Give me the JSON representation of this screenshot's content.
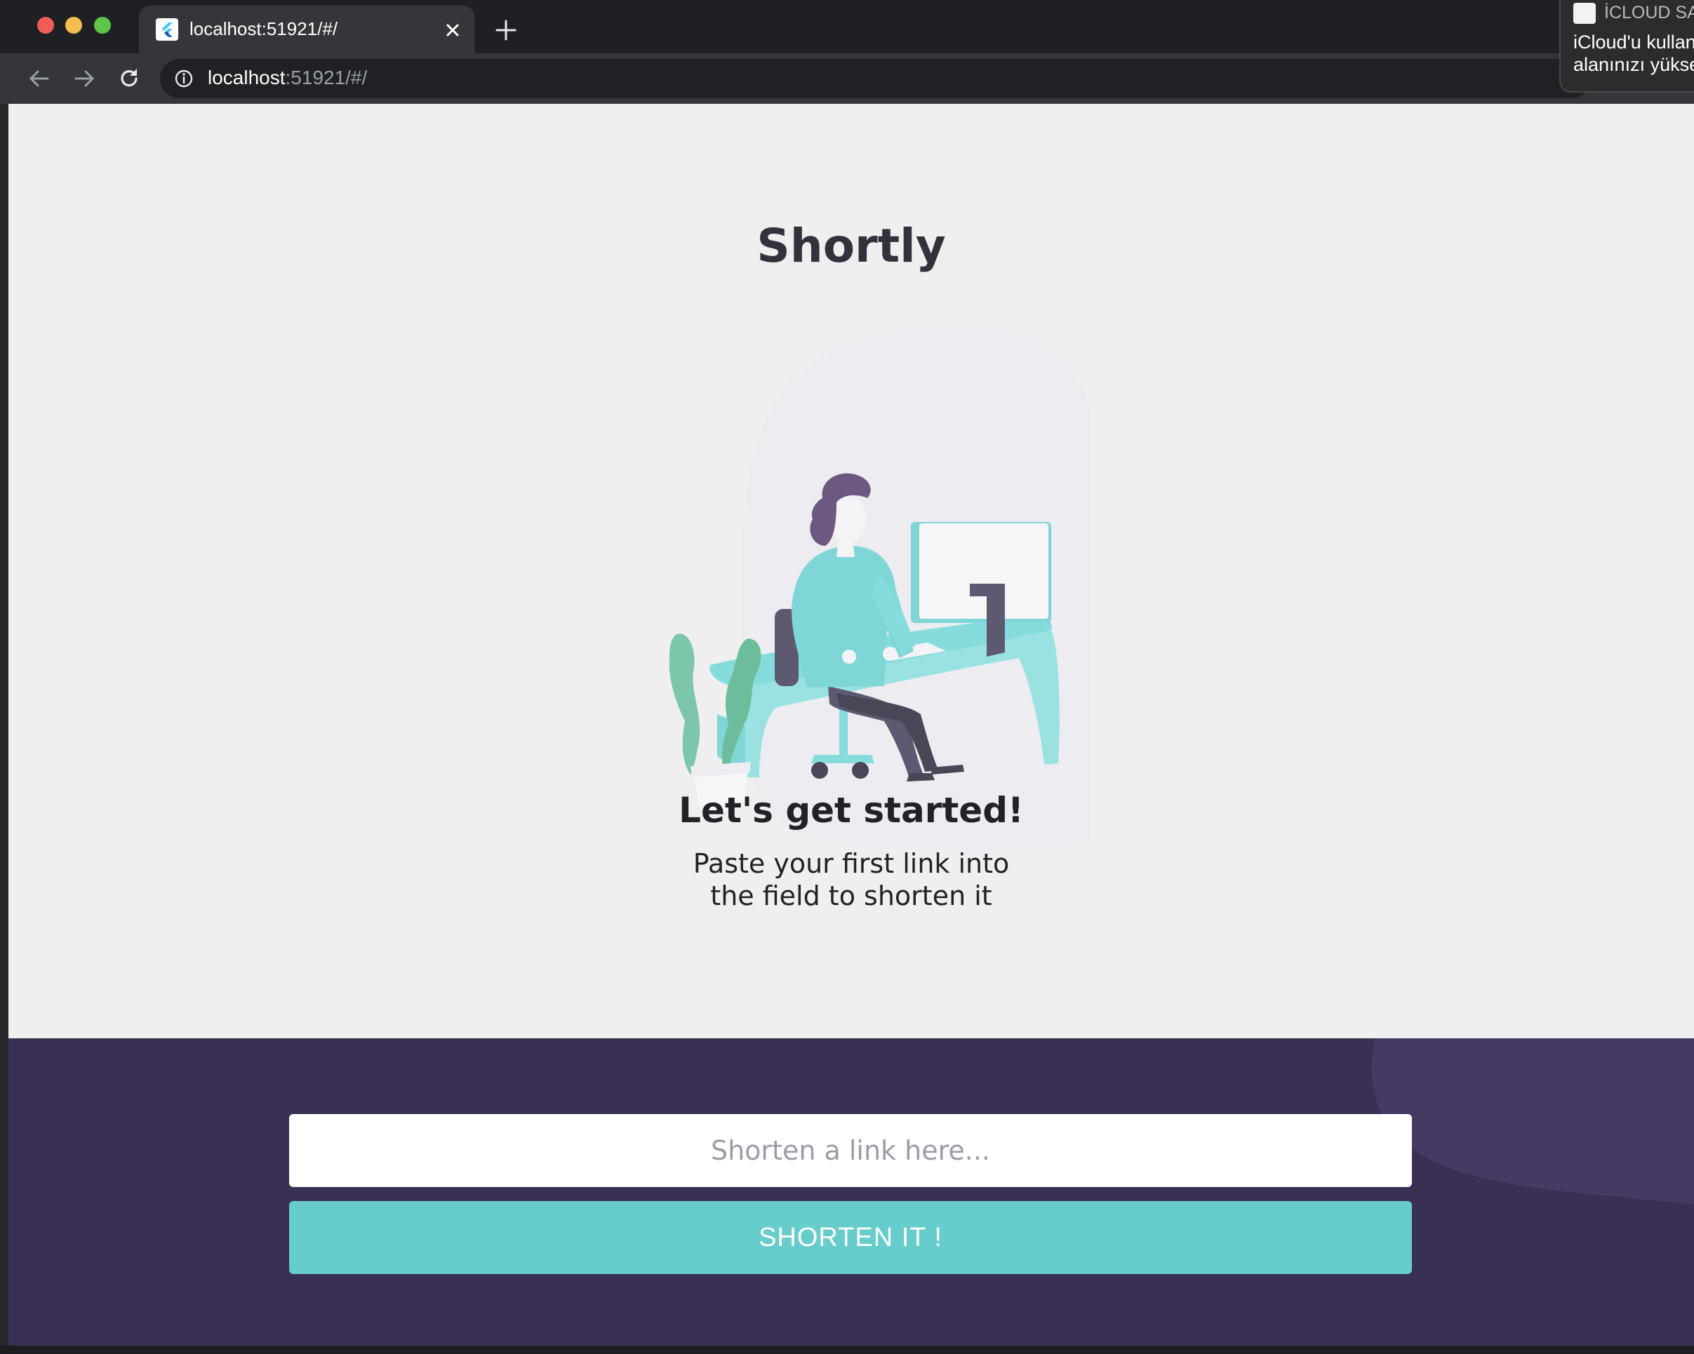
{
  "browser": {
    "tab_title": "localhost:51921/#/",
    "url_host": "localhost",
    "url_rest": ":51921/#/"
  },
  "notification": {
    "app": "İCLOUD SA",
    "line1": "iCloud'u kullan",
    "line2": "alanınızı yükse"
  },
  "page": {
    "title": "Shortly",
    "headline": "Let's get started!",
    "subtext_line1": "Paste your first link into",
    "subtext_line2": "the field to shorten it"
  },
  "form": {
    "placeholder": "Shorten a link here...",
    "button_label": "SHORTEN IT !"
  },
  "colors": {
    "background": "#efefef",
    "panel": "#3a3054",
    "accent": "#66cccc",
    "title": "#34313d"
  },
  "icons": {
    "favicon": "flutter-icon",
    "close": "close-icon",
    "new_tab": "plus-icon",
    "back": "arrow-left-icon",
    "forward": "arrow-right-icon",
    "reload": "reload-icon",
    "info": "info-icon",
    "star": "star-icon"
  }
}
